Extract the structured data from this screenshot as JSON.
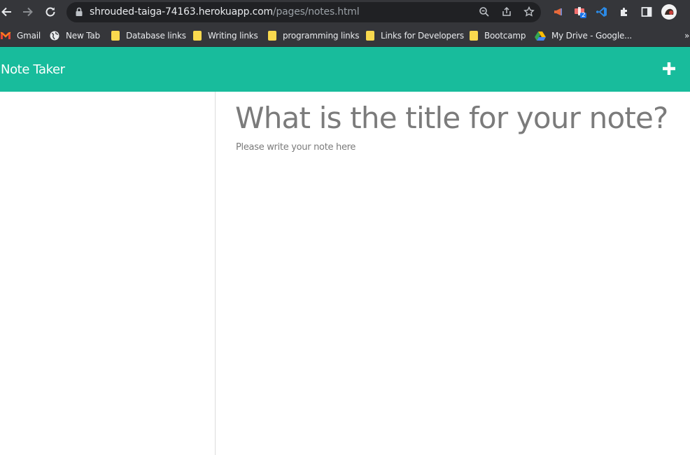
{
  "browser": {
    "url_host": "shrouded-taiga-74163.herokuapp.com",
    "url_path": "/pages/notes.html",
    "extension_badge": "2",
    "bookmarks": [
      {
        "label": "Gmail",
        "icon": "gmail-icon"
      },
      {
        "label": "New Tab",
        "icon": "globe-icon"
      },
      {
        "label": "Database links",
        "icon": "folder-icon"
      },
      {
        "label": "Writing links",
        "icon": "folder-icon"
      },
      {
        "label": "programming links",
        "icon": "folder-icon"
      },
      {
        "label": "Links for Developers",
        "icon": "folder-icon"
      },
      {
        "label": "Bootcamp",
        "icon": "folder-icon"
      },
      {
        "label": "My Drive - Google...",
        "icon": "google-drive-icon"
      }
    ],
    "overflow": "»"
  },
  "app": {
    "brand": "Note Taker",
    "header_color": "#18bc9c",
    "add_icon": "plus-icon"
  },
  "editor": {
    "title_placeholder": "What is the title for your note?",
    "text_placeholder": "Please write your note here"
  }
}
